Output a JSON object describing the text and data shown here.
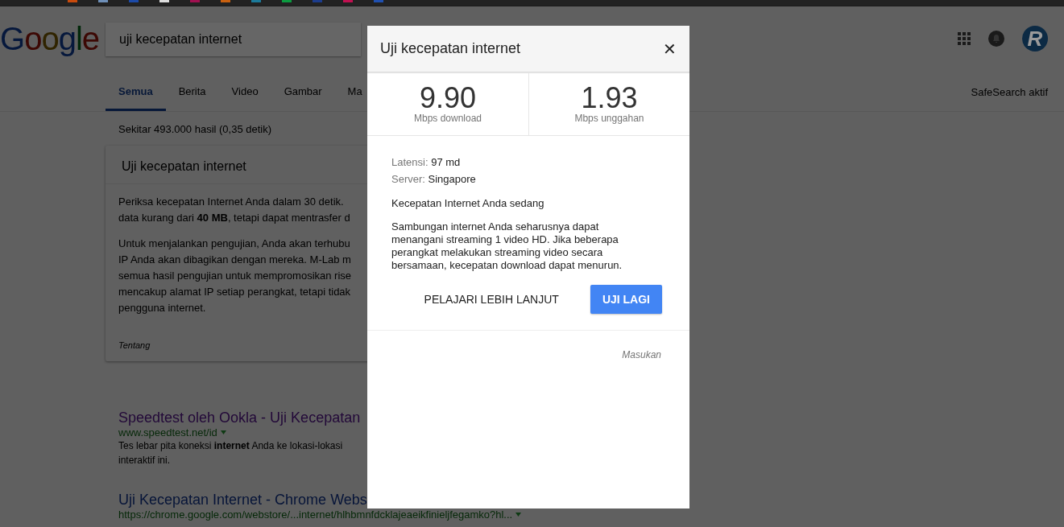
{
  "logo": "Google",
  "search": {
    "value": "uji kecepatan internet"
  },
  "avatar": {
    "letter": "R"
  },
  "tabs": [
    {
      "label": "Semua",
      "selected": true
    },
    {
      "label": "Berita",
      "selected": false
    },
    {
      "label": "Video",
      "selected": false
    },
    {
      "label": "Gambar",
      "selected": false
    },
    {
      "label": "Ma",
      "selected": false
    }
  ],
  "safesearch": "SafeSearch aktif",
  "result_stats": "Sekitar 493.000 hasil (0,35 detik)",
  "card": {
    "title": "Uji kecepatan internet",
    "paragraphs": [
      [
        "Periksa kecepatan Internet Anda dalam 30 detik.",
        "data kurang dari **40 MB**, tetapi dapat mentrasfer d"
      ],
      [
        "Untuk menjalankan pengujian, Anda akan terhubu",
        "IP Anda akan dibagikan dengan mereka. M-Lab m",
        "semua hasil pengujian untuk mempromosikan rise",
        "mencakup alamat IP setiap perangkat, tetapi tidak",
        "pengguna internet."
      ]
    ],
    "footer": "Tentang"
  },
  "results": [
    {
      "title": "Speedtest oleh Ookla - Uji Kecepatan",
      "url": "www.speedtest.net/id",
      "snippet": [
        "Tes lebar pita koneksi **internet** Anda ke lokasi-lokasi",
        "interaktif ini."
      ]
    },
    {
      "title": "Uji Kecepatan Internet - Chrome Webs",
      "url": "https://chrome.google.com/webstore/...internet/hlhbmnfdcklajeaeikfinieljfegamko?hl..."
    }
  ],
  "dialog": {
    "title": "Uji kecepatan internet",
    "close": "✕",
    "speeds": [
      {
        "value": "9.90",
        "label": "Mbps download"
      },
      {
        "value": "1.93",
        "label": "Mbps unggahan"
      }
    ],
    "details": [
      {
        "label": "Latensi:",
        "value": "97 md"
      },
      {
        "label": "Server:",
        "value": "Singapore"
      }
    ],
    "heading": "Kecepatan Internet Anda sedang",
    "description": "Sambungan internet Anda seharusnya dapat menangani streaming 1 video HD. Jika beberapa perangkat melakukan streaming video secara bersamaan, kecepatan download dapat menurun.",
    "buttons": [
      {
        "label": "PELAJARI LEBIH LANJUT",
        "kind": "flat"
      },
      {
        "label": "UJI LAGI",
        "kind": "primary"
      }
    ],
    "feedback": "Masukan"
  }
}
